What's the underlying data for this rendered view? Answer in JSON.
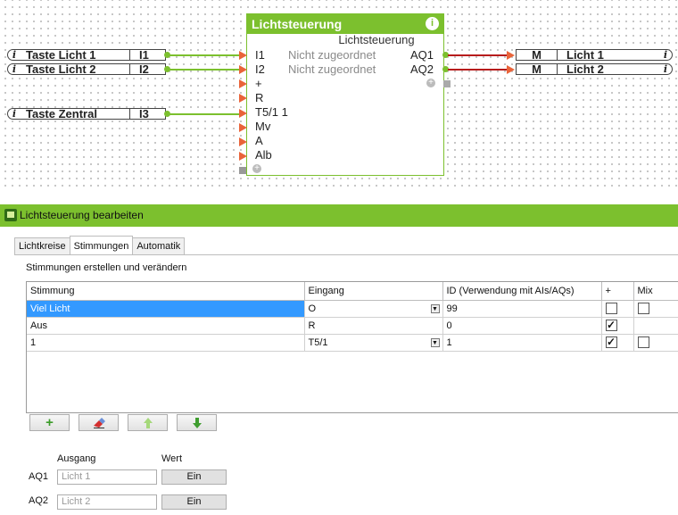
{
  "diagram": {
    "inputs": [
      {
        "name": "Taste Licht 1",
        "id": "I1"
      },
      {
        "name": "Taste Licht 2",
        "id": "I2"
      },
      {
        "name": "Taste Zentral",
        "id": "I3"
      }
    ],
    "outputs": [
      {
        "id": "M",
        "name": "Licht 1"
      },
      {
        "id": "M",
        "name": "Licht 2"
      }
    ],
    "info_glyph": "i",
    "block": {
      "title": "Lichtsteuerung",
      "subtitle": "Lichtsteuerung",
      "ports_left": [
        "I1",
        "I2",
        "+",
        "R",
        "T5/1 1",
        "Mv",
        "A",
        "Alb"
      ],
      "unassigned": [
        "Nicht zugeordnet",
        "Nicht zugeordnet"
      ],
      "ports_right": [
        "AQ1",
        "AQ2"
      ],
      "info_icon": "info-icon",
      "accent": "#7cc02e"
    }
  },
  "dialog": {
    "title": "Lichtsteuerung bearbeiten",
    "tabs": [
      {
        "label": "Lichtkreise",
        "active": false
      },
      {
        "label": "Stimmungen",
        "active": true
      },
      {
        "label": "Automatik",
        "active": false
      }
    ],
    "section_title": "Stimmungen erstellen und verändern",
    "table": {
      "headers": [
        "Stimmung",
        "Eingang",
        "ID (Verwendung mit AIs/AQs)",
        "+",
        "Mix"
      ],
      "rows": [
        {
          "stimmung": "Viel Licht",
          "eingang": "O",
          "id": "99",
          "plus": false,
          "mix": false,
          "has_dropdown": true,
          "selected": true
        },
        {
          "stimmung": "Aus",
          "eingang": "R",
          "id": "0",
          "plus": true,
          "mix": null,
          "has_dropdown": false,
          "selected": false
        },
        {
          "stimmung": "1",
          "eingang": "T5/1",
          "id": "1",
          "plus": true,
          "mix": false,
          "has_dropdown": true,
          "selected": false
        }
      ]
    },
    "toolbar": [
      "add-icon",
      "eraser-icon",
      "arrow-up-icon",
      "arrow-down-icon"
    ],
    "output_headers": {
      "ausgang": "Ausgang",
      "wert": "Wert"
    },
    "outputs": [
      {
        "label": "AQ1",
        "placeholder": "Licht 1",
        "value": "Ein"
      },
      {
        "label": "AQ2",
        "placeholder": "Licht 2",
        "value": "Ein"
      }
    ]
  }
}
